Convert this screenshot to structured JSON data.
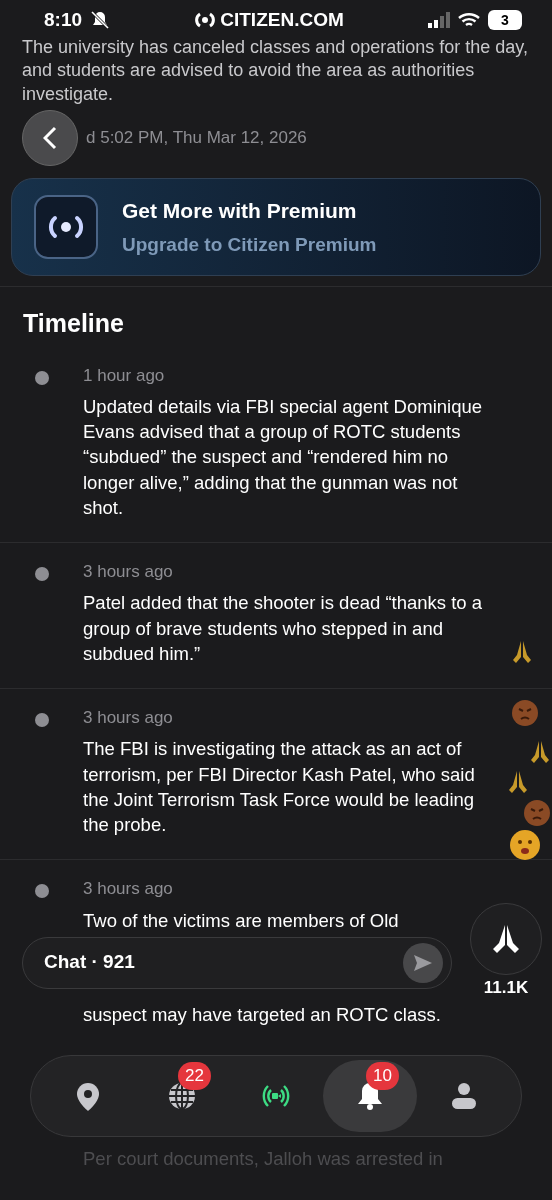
{
  "status_bar": {
    "time": "8:10",
    "site": "CITIZEN.COM",
    "battery": "3"
  },
  "article": {
    "paragraph": "The university has canceled classes and operations for the day, and students are advised to avoid the area as authorities investigate.",
    "updated": "d 5:02 PM, Thu Mar 12, 2026"
  },
  "premium": {
    "title": "Get More with Premium",
    "subtitle": "Upgrade to Citizen Premium"
  },
  "timeline": {
    "title": "Timeline",
    "entries": [
      {
        "kind": "plain",
        "time": "1 hour ago",
        "text": [
          "Updated details via FBI special agent Dominique Evans advised that a group of ROTC students “subdued” the suspect and “rendered him no longer alive,” adding that the gunman was not shot."
        ]
      },
      {
        "kind": "plain",
        "time": "3 hours ago",
        "text": [
          "Patel added that the shooter is dead “thanks to a group of brave students who stepped in and subdued him.”"
        ]
      },
      {
        "kind": "plain",
        "time": "3 hours ago",
        "text": [
          "The FBI is investigating the attack as an act of terrorism, per FBI Director Kash Patel, who said the Joint Terrorism Task Force would be leading the probe."
        ]
      },
      {
        "kind": "with-chat",
        "time": "3 hours ago",
        "text": [
          "Two of the victims are members of Old",
          "suspect may have targeted an ROTC class."
        ]
      }
    ]
  },
  "chat": {
    "label": "Chat · 921",
    "reactions": "11.1K"
  },
  "nav": [
    {
      "kind": "map",
      "selected": false
    },
    {
      "kind": "globe",
      "badge": "22",
      "selected": false
    },
    {
      "kind": "live",
      "selected": false
    },
    {
      "kind": "bell",
      "badge": "10",
      "selected": true
    },
    {
      "kind": "profile",
      "selected": false
    }
  ],
  "next_entry": {
    "text": "Per court documents, Jalloh was arrested in"
  }
}
